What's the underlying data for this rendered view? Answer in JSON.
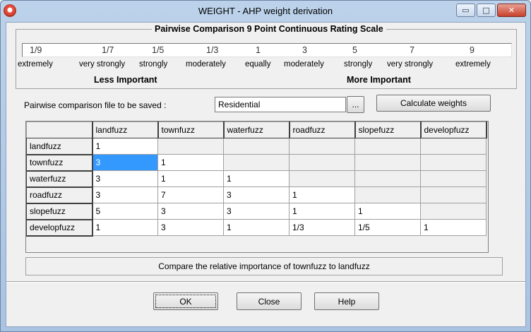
{
  "window": {
    "title": "WEIGHT - AHP weight derivation",
    "controls": {
      "minimize": "▭",
      "maximize": "□",
      "close": "✕"
    }
  },
  "scale": {
    "title": "Pairwise Comparison 9 Point Continuous Rating Scale",
    "values": [
      "1/9",
      "1/7",
      "1/5",
      "1/3",
      "1",
      "3",
      "5",
      "7",
      "9"
    ],
    "words": [
      "extremely",
      "very strongly",
      "strongly",
      "moderately",
      "equally",
      "moderately",
      "strongly",
      "very strongly",
      "extremely"
    ],
    "less_label": "Less Important",
    "more_label": "More Important"
  },
  "file": {
    "label": "Pairwise comparison file to be saved :",
    "value": "Residential",
    "browse_label": "...",
    "calculate_label": "Calculate weights"
  },
  "matrix": {
    "columns": [
      "landfuzz",
      "townfuzz",
      "waterfuzz",
      "roadfuzz",
      "slopefuzz",
      "developfuzz"
    ],
    "rows": [
      {
        "name": "landfuzz",
        "cells": [
          "1",
          "",
          "",
          "",
          "",
          ""
        ]
      },
      {
        "name": "townfuzz",
        "cells": [
          "3",
          "1",
          "",
          "",
          "",
          ""
        ]
      },
      {
        "name": "waterfuzz",
        "cells": [
          "3",
          "1",
          "1",
          "",
          "",
          ""
        ]
      },
      {
        "name": "roadfuzz",
        "cells": [
          "3",
          "7",
          "3",
          "1",
          "",
          ""
        ]
      },
      {
        "name": "slopefuzz",
        "cells": [
          "5",
          "3",
          "3",
          "1",
          "1",
          ""
        ]
      },
      {
        "name": "developfuzz",
        "cells": [
          "1",
          "3",
          "1",
          "1/3",
          "1/5",
          "1"
        ]
      }
    ],
    "selected_cell": {
      "row": 1,
      "col": 0
    }
  },
  "status": {
    "text": "Compare the relative importance of townfuzz to landfuzz"
  },
  "buttons": {
    "ok": "OK",
    "close": "Close",
    "help": "Help"
  }
}
